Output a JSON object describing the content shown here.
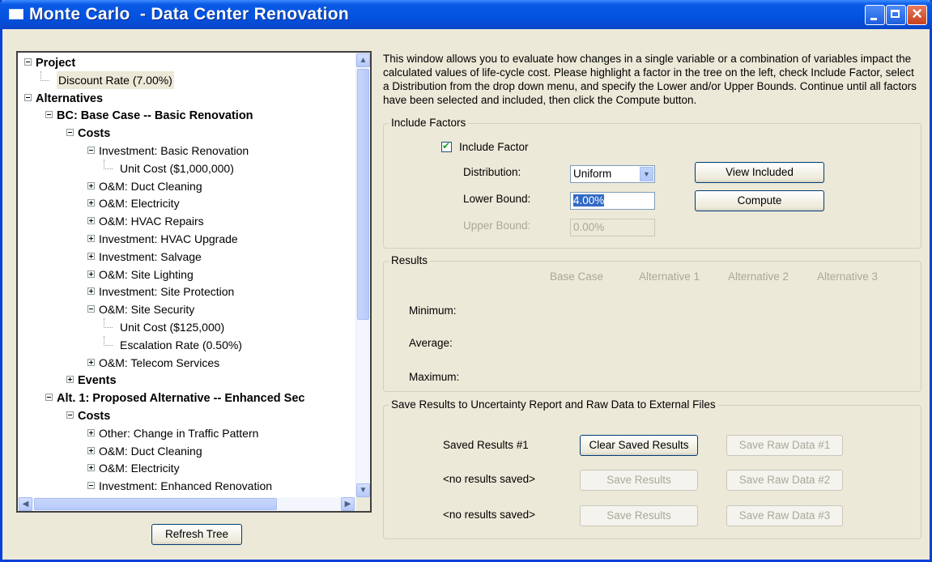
{
  "window": {
    "title": "Monte Carlo  - Data Center Renovation"
  },
  "tree": {
    "items": [
      {
        "label": "Project",
        "bold": true
      },
      {
        "label": "Discount Rate (7.00%)",
        "selected": true
      },
      {
        "label": "Alternatives",
        "bold": true
      },
      {
        "label": "BC: Base Case -- Basic Renovation",
        "bold": true
      },
      {
        "label": "Costs",
        "bold": true
      },
      {
        "label": "Investment: Basic Renovation"
      },
      {
        "label": "Unit Cost ($1,000,000)"
      },
      {
        "label": "O&M: Duct Cleaning"
      },
      {
        "label": "O&M: Electricity"
      },
      {
        "label": "O&M: HVAC Repairs"
      },
      {
        "label": "Investment: HVAC Upgrade"
      },
      {
        "label": "Investment: Salvage"
      },
      {
        "label": "O&M: Site Lighting"
      },
      {
        "label": "Investment: Site Protection"
      },
      {
        "label": "O&M: Site Security"
      },
      {
        "label": "Unit Cost ($125,000)"
      },
      {
        "label": "Escalation Rate (0.50%)"
      },
      {
        "label": "O&M: Telecom Services"
      },
      {
        "label": "Events",
        "bold": true
      },
      {
        "label": "Alt. 1: Proposed Alternative -- Enhanced Sec",
        "bold": true
      },
      {
        "label": "Costs",
        "bold": true
      },
      {
        "label": "Other: Change in Traffic Pattern"
      },
      {
        "label": "O&M: Duct Cleaning"
      },
      {
        "label": "O&M: Electricity"
      },
      {
        "label": "Investment: Enhanced Renovation"
      }
    ]
  },
  "refresh_label": "Refresh Tree",
  "description": "This window allows you to evaluate how changes in a single variable or a combination of variables impact the calculated values of life-cycle cost.  Please highlight a factor in the tree on the left, check Include Factor, select a Distribution from the drop down menu, and specify the Lower and/or Upper Bounds.  Continue until all factors have been selected and included, then click the Compute button.",
  "include": {
    "legend": "Include Factors",
    "checkbox_label": "Include Factor",
    "checked": true,
    "distribution_label": "Distribution:",
    "distribution_value": "Uniform",
    "lower_label": "Lower Bound:",
    "lower_value": "4.00%",
    "upper_label": "Upper Bound:",
    "upper_value": "0.00%",
    "view_included": "View Included",
    "compute": "Compute"
  },
  "results": {
    "legend": "Results",
    "columns": [
      "Base Case",
      "Alternative 1",
      "Alternative 2",
      "Alternative 3"
    ],
    "rows": [
      "Minimum:",
      "Average:",
      "Maximum:"
    ]
  },
  "save": {
    "legend": "Save Results to Uncertainty Report and Raw Data to External Files",
    "rows": [
      {
        "label": "Saved Results #1",
        "save_btn": "Clear Saved Results",
        "save_enabled": true,
        "raw_btn": "Save Raw Data #1"
      },
      {
        "label": "<no results saved>",
        "save_btn": "Save Results",
        "save_enabled": false,
        "raw_btn": "Save Raw Data #2"
      },
      {
        "label": "<no results saved>",
        "save_btn": "Save Results",
        "save_enabled": false,
        "raw_btn": "Save Raw Data #3"
      }
    ]
  }
}
